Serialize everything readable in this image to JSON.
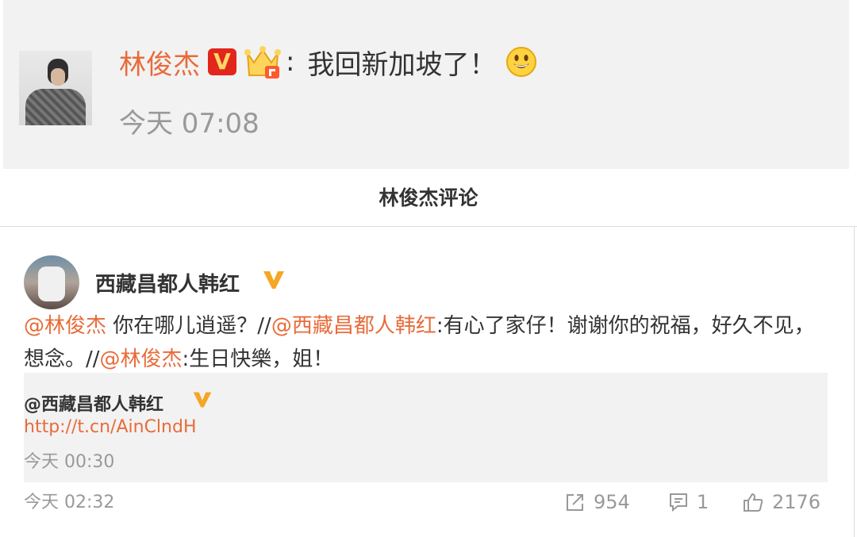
{
  "post": {
    "author": "林俊杰",
    "colon": ":",
    "text": "我回新加坡了！",
    "time": "今天 07:08",
    "icons": [
      "avatar",
      "verified-v-icon",
      "crown-icon",
      "smile-emoji-icon"
    ]
  },
  "section_title": "林俊杰评论",
  "comment": {
    "author": "西藏昌都人韩红",
    "parts": [
      {
        "t": "@林俊杰",
        "m": true
      },
      {
        "t": " 你在哪儿逍遥？//",
        "m": false
      },
      {
        "t": "@西藏昌都人韩红",
        "m": true
      },
      {
        "t": ":有心了家仔！谢谢你的祝福，好久不见，想念。//",
        "m": false
      },
      {
        "t": "@林俊杰",
        "m": true
      },
      {
        "t": ":生日快樂，姐！",
        "m": false
      }
    ],
    "quote": {
      "author": "@西藏昌都人韩红",
      "link": "http://t.cn/AinClndH",
      "time": "今天 00:30"
    },
    "time": "今天 02:32",
    "actions": {
      "repost": "954",
      "comments": "1",
      "likes": "2176"
    }
  },
  "colors": {
    "accent": "#e86b3a",
    "muted": "#999999",
    "card_bg": "#f2f2f2",
    "verified_gold": "#f5a623",
    "verified_red": "#e2261b"
  }
}
